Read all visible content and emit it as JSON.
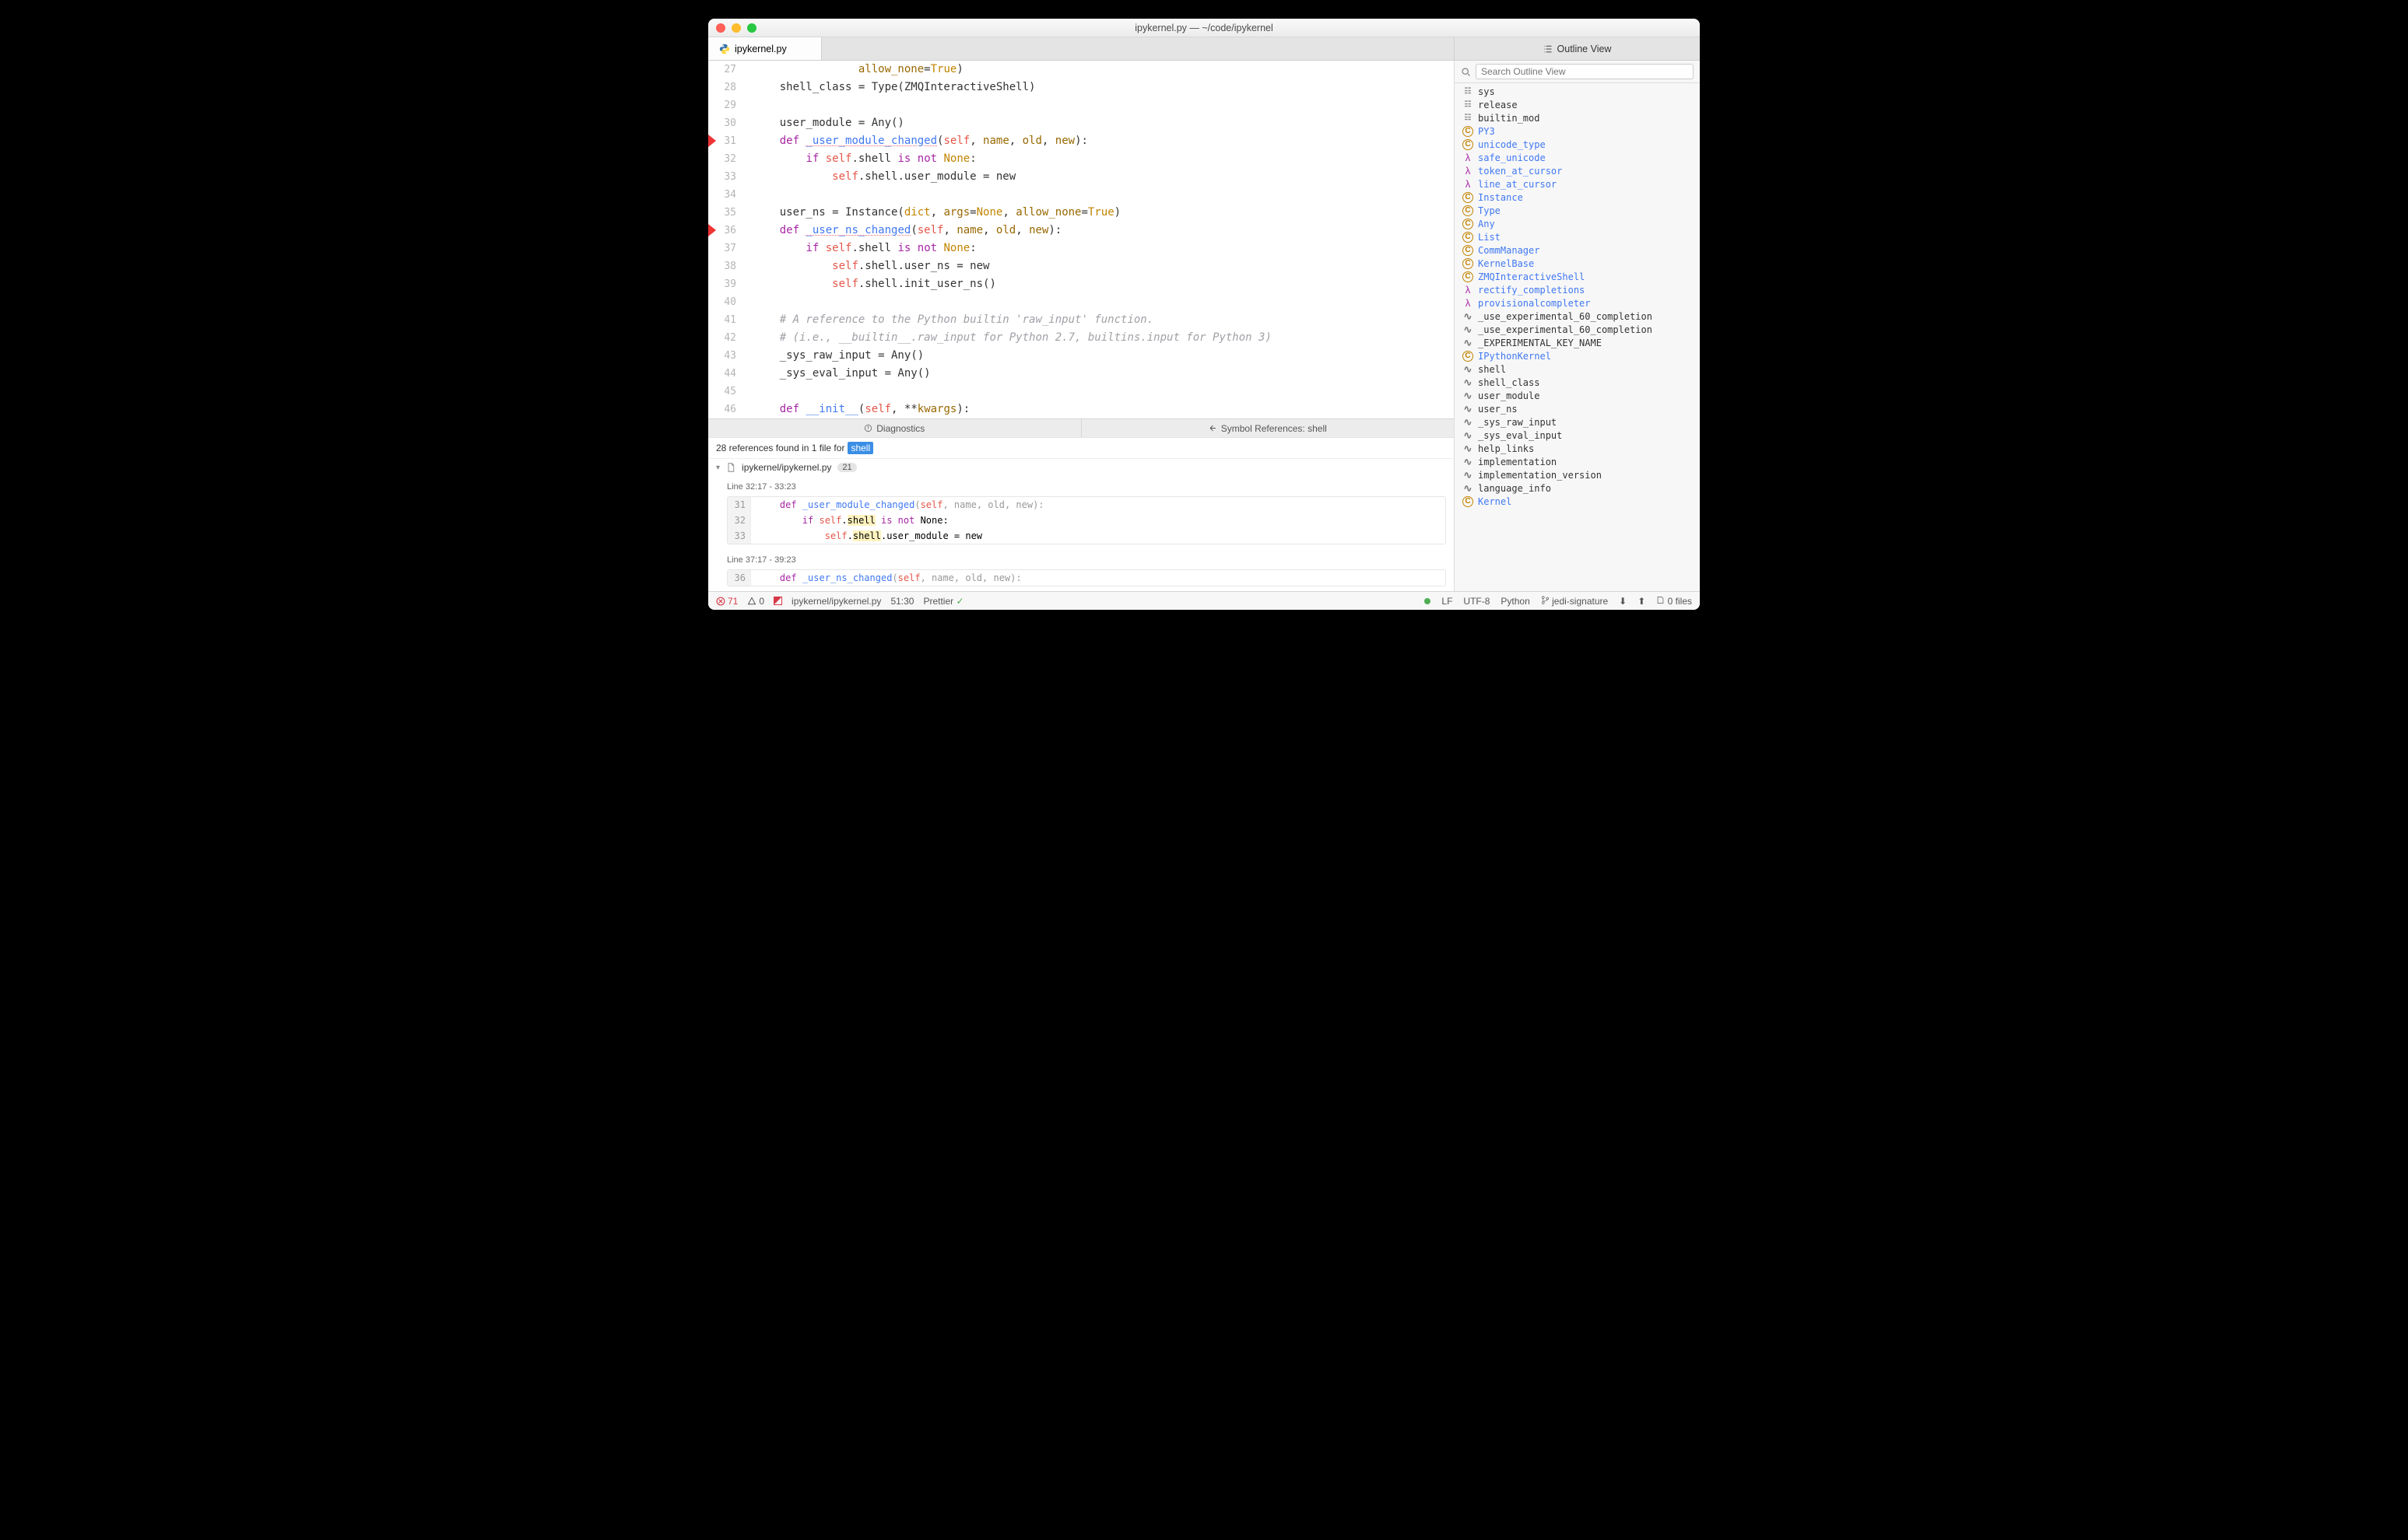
{
  "window": {
    "title": "ipykernel.py — ~/code/ipykernel"
  },
  "tab": {
    "filename": "ipykernel.py"
  },
  "outline_tab_title": "Outline View",
  "editor": {
    "lines": [
      {
        "n": 27,
        "bp": false,
        "html": "                <span class='arg'>allow_none</span><span class='op'>=</span><span class='lit'>True</span>)"
      },
      {
        "n": 28,
        "bp": false,
        "html": "    shell_class = Type(ZMQInteractiveShell)"
      },
      {
        "n": 29,
        "bp": false,
        "html": ""
      },
      {
        "n": 30,
        "bp": false,
        "html": "    user_module = Any()"
      },
      {
        "n": 31,
        "bp": true,
        "html": "    <span class='kw'>def</span> <span class='fn und-r'>_user_module_changed</span>(<span class='self'>self</span>, <span class='arg'>name</span>, <span class='arg'>old</span>, <span class='arg'>new</span>):"
      },
      {
        "n": 32,
        "bp": false,
        "html": "        <span class='kw'>if</span> <span class='self'>self</span>.shell <span class='kw'>is</span> <span class='kw'>not</span> <span class='lit'>None</span>:"
      },
      {
        "n": 33,
        "bp": false,
        "html": "            <span class='self'>self</span>.shell.user_module = new"
      },
      {
        "n": 34,
        "bp": false,
        "html": ""
      },
      {
        "n": 35,
        "bp": false,
        "html": "    user_ns = Instance(<span class='tp'>dict</span>, <span class='arg'>args</span>=<span class='lit'>None</span>, <span class='arg'>allow_none</span>=<span class='lit'>True</span>)"
      },
      {
        "n": 36,
        "bp": true,
        "html": "    <span class='kw'>def</span> <span class='fn und-r'>_user_ns_changed</span>(<span class='self'>self</span>, <span class='arg'>name</span>, <span class='arg'>old</span>, <span class='arg'>new</span>):"
      },
      {
        "n": 37,
        "bp": false,
        "html": "        <span class='kw'>if</span> <span class='self'>self</span>.shell <span class='kw'>is</span> <span class='kw'>not</span> <span class='lit'>None</span>:"
      },
      {
        "n": 38,
        "bp": false,
        "html": "            <span class='self'>self</span>.shell.user_ns = new"
      },
      {
        "n": 39,
        "bp": false,
        "html": "            <span class='self'>self</span>.shell.init_user_ns()"
      },
      {
        "n": 40,
        "bp": false,
        "html": ""
      },
      {
        "n": 41,
        "bp": false,
        "html": "    <span class='cmt'># A reference to the Python builtin 'raw_input' function.</span>"
      },
      {
        "n": 42,
        "bp": false,
        "html": "    <span class='cmt'># (i.e., __builtin__.raw_input for Python 2.7, builtins.input for Python 3)</span>"
      },
      {
        "n": 43,
        "bp": false,
        "html": "    _sys_raw_input = Any()"
      },
      {
        "n": 44,
        "bp": false,
        "html": "    _sys_eval_input = Any()"
      },
      {
        "n": 45,
        "bp": false,
        "html": ""
      },
      {
        "n": 46,
        "bp": false,
        "html": "    <span class='kw'>def</span> <span class='fn'>__init__</span>(<span class='self'>self</span>, **<span class='arg'>kwargs</span>):"
      }
    ]
  },
  "bottom": {
    "tab_diag": "Diagnostics",
    "tab_refs": "Symbol References: shell"
  },
  "refs": {
    "summary_prefix": "28 references found in 1 file for",
    "summary_symbol": "shell",
    "file_path": "ipykernel/ipykernel.py",
    "file_count": "21",
    "blocks": [
      {
        "range": "Line 32:17 - 33:23",
        "lines": [
          {
            "n": 31,
            "fade": true,
            "html": "    <span class='kw'>def</span> <span class='fn'>_user_module_changed</span>(<span class='self'>self</span>, name, old, new):"
          },
          {
            "n": 32,
            "fade": false,
            "html": "        <span class='kw'>if</span> <span class='self'>self</span>.<span class='hlbg'>shell</span> <span class='kw'>is</span> <span class='kw'>not</span> None:"
          },
          {
            "n": 33,
            "fade": false,
            "html": "            <span class='self'>self</span>.<span class='hlbg'>shell</span>.user_module = new"
          }
        ]
      },
      {
        "range": "Line 37:17 - 39:23",
        "lines": [
          {
            "n": 36,
            "fade": true,
            "html": "    <span class='kw'>def</span> <span class='fn'>_user_ns_changed</span>(<span class='self'>self</span>, name, old, new):"
          }
        ]
      }
    ]
  },
  "outline": {
    "search_placeholder": "Search Outline View",
    "items": [
      {
        "icon": "pkg",
        "label": "sys",
        "link": false
      },
      {
        "icon": "pkg",
        "label": "release",
        "link": false
      },
      {
        "icon": "pkg",
        "label": "builtin_mod",
        "link": false
      },
      {
        "icon": "cls",
        "label": "PY3",
        "link": true
      },
      {
        "icon": "cls",
        "label": "unicode_type",
        "link": true
      },
      {
        "icon": "fn",
        "label": "safe_unicode",
        "link": true
      },
      {
        "icon": "fn",
        "label": "token_at_cursor",
        "link": true
      },
      {
        "icon": "fn",
        "label": "line_at_cursor",
        "link": true
      },
      {
        "icon": "cls",
        "label": "Instance",
        "link": true
      },
      {
        "icon": "cls",
        "label": "Type",
        "link": true
      },
      {
        "icon": "cls",
        "label": "Any",
        "link": true
      },
      {
        "icon": "cls",
        "label": "List",
        "link": true
      },
      {
        "icon": "cls",
        "label": "CommManager",
        "link": true
      },
      {
        "icon": "cls",
        "label": "KernelBase",
        "link": true
      },
      {
        "icon": "cls",
        "label": "ZMQInteractiveShell",
        "link": true
      },
      {
        "icon": "fn",
        "label": "rectify_completions",
        "link": true
      },
      {
        "icon": "fn",
        "label": "provisionalcompleter",
        "link": true
      },
      {
        "icon": "var",
        "label": "_use_experimental_60_completion",
        "link": false
      },
      {
        "icon": "var",
        "label": "_use_experimental_60_completion",
        "link": false
      },
      {
        "icon": "var",
        "label": "_EXPERIMENTAL_KEY_NAME",
        "link": false
      },
      {
        "icon": "cls",
        "label": "IPythonKernel",
        "link": true
      },
      {
        "icon": "var",
        "label": "shell",
        "link": false
      },
      {
        "icon": "var",
        "label": "shell_class",
        "link": false
      },
      {
        "icon": "var",
        "label": "user_module",
        "link": false
      },
      {
        "icon": "var",
        "label": "user_ns",
        "link": false
      },
      {
        "icon": "var",
        "label": "_sys_raw_input",
        "link": false
      },
      {
        "icon": "var",
        "label": "_sys_eval_input",
        "link": false
      },
      {
        "icon": "var",
        "label": "help_links",
        "link": false
      },
      {
        "icon": "var",
        "label": "implementation",
        "link": false
      },
      {
        "icon": "var",
        "label": "implementation_version",
        "link": false
      },
      {
        "icon": "var",
        "label": "language_info",
        "link": false
      },
      {
        "icon": "cls",
        "label": "Kernel",
        "link": true
      }
    ]
  },
  "status": {
    "errors": "71",
    "warnings": "0",
    "path": "ipykernel/ipykernel.py",
    "cursor": "51:30",
    "prettier": "Prettier",
    "lf": "LF",
    "encoding": "UTF-8",
    "language": "Python",
    "branch": "jedi-signature",
    "files": "0 files"
  }
}
